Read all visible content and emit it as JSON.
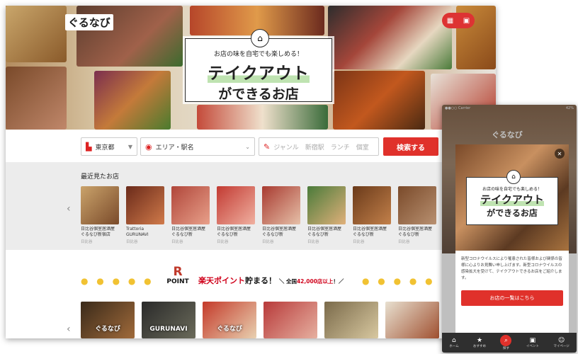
{
  "hero": {
    "logo": "ぐるなび",
    "subtitle": "お店の味を自宅でも楽しめる！",
    "title_line1": "テイクアウト",
    "title_line2": "ができるお店"
  },
  "search": {
    "prefecture": "東京都",
    "area_label": "エリア・駅名",
    "keyword_placeholder": "ジャンル　新宿駅　ランチ　個室",
    "button": "検索する"
  },
  "recent": {
    "title": "最近見たお店",
    "items": [
      {
        "name": "日比谷個室居酒屋ぐるなび新宿店",
        "area": "日比谷"
      },
      {
        "name": "Trattoria GURUNAVI",
        "area": "日比谷"
      },
      {
        "name": "日比谷個室居酒屋ぐるなび新",
        "area": "日比谷"
      },
      {
        "name": "日比谷個室居酒屋ぐるなび新",
        "area": "日比谷"
      },
      {
        "name": "日比谷個室居酒屋ぐるなび新",
        "area": "日比谷"
      },
      {
        "name": "日比谷個室居酒屋ぐるなび新",
        "area": "日比谷"
      },
      {
        "name": "日比谷個室居酒屋ぐるなび新",
        "area": "日比谷"
      },
      {
        "name": "日比谷個室居酒屋ぐるなび新",
        "area": "日比谷"
      }
    ]
  },
  "points": {
    "logo_r": "R",
    "logo_point": "POINT",
    "headline_red": "楽天ポイント",
    "headline_black": "貯まる！",
    "note_pre": "＼ 全国",
    "note_red": "42,000店以上",
    "note_post": "！／"
  },
  "banners": [
    {
      "label": "ぐるなび"
    },
    {
      "label": "GURUNAVI"
    },
    {
      "label": "ぐるなび"
    },
    {
      "label": ""
    },
    {
      "label": ""
    },
    {
      "label": ""
    }
  ],
  "phone": {
    "status_left": "●●○○ Carrier",
    "status_right": "42%",
    "logo": "ぐるなび",
    "card_subtitle": "お店の味を自宅でも楽しめる！",
    "card_title1": "テイクアウト",
    "card_title2": "ができるお店",
    "body_text": "新型コロナウイルスにより罹患された皆様および関係の皆様に心よりお見舞い申し上げます。新型コロナウイルスの感染拡大を受けて、テイクアウトできるお店をご紹介します。",
    "button": "お店の一覧はこちら",
    "tabs": [
      {
        "icon": "home-icon",
        "glyph": "⌂",
        "label": "ホーム"
      },
      {
        "icon": "star-icon",
        "glyph": "★",
        "label": "おすすめ"
      },
      {
        "icon": "search-icon",
        "glyph": "⌕",
        "label": "探す"
      },
      {
        "icon": "lock-icon",
        "glyph": "▣",
        "label": "イベント"
      },
      {
        "icon": "person-icon",
        "glyph": "☺",
        "label": "マイページ"
      }
    ]
  },
  "colors": {
    "accent_red": "#e0312b",
    "highlight_green": "#bfe3b1",
    "coin_gold": "#f1c232"
  }
}
